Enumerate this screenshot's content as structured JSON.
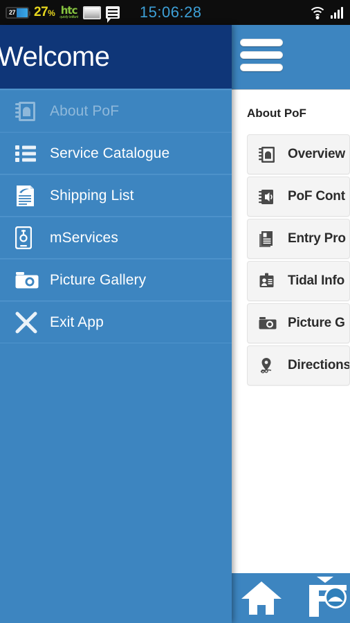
{
  "status_bar": {
    "battery_level_label": "27",
    "battery_percent": "27",
    "percent_symbol": "%",
    "brand": "htc",
    "brand_tagline": "quietly brilliant",
    "picture_icon": "picture-icon",
    "message_icon": "message-icon",
    "clock": "15:06:28",
    "wifi_icon": "wifi-icon",
    "signal_icon": "signal-bars-icon",
    "clock_color": "#3d9fd6",
    "battery_text_color": "#e8d71e",
    "brand_color": "#86c440",
    "background": "#0d0d0d"
  },
  "drawer": {
    "title": "Welcome",
    "header_bg": "#0f3678",
    "body_bg": "#3d85c0",
    "items": [
      {
        "label": "About PoF",
        "icon": "notebook-icon",
        "selected": true
      },
      {
        "label": "Service Catalogue",
        "icon": "list-icon",
        "selected": false
      },
      {
        "label": "Shipping List",
        "icon": "document-icon",
        "selected": false
      },
      {
        "label": "mServices",
        "icon": "mobile-gear-icon",
        "selected": false
      },
      {
        "label": "Picture Gallery",
        "icon": "camera-icon",
        "selected": false
      },
      {
        "label": "Exit App",
        "icon": "close-x-icon",
        "selected": false
      }
    ]
  },
  "content": {
    "menu_icon": "hamburger-menu-icon",
    "header_bg": "#3d85c0",
    "page_title": "About PoF",
    "cards": [
      {
        "label": "Overview",
        "icon": "notebook-icon"
      },
      {
        "label": "PoF Cont",
        "icon": "audio-book-icon"
      },
      {
        "label": "Entry Pro",
        "icon": "book-icon"
      },
      {
        "label": "Tidal Info",
        "icon": "id-card-icon"
      },
      {
        "label": "Picture G",
        "icon": "camera-icon"
      },
      {
        "label": "Directions",
        "icon": "location-pin-icon"
      }
    ]
  },
  "bottom_bar": {
    "background": "#3d85c0",
    "buttons": [
      {
        "icon": "home-icon",
        "label": ""
      },
      {
        "icon": "port-logo-icon",
        "label": ""
      }
    ]
  }
}
